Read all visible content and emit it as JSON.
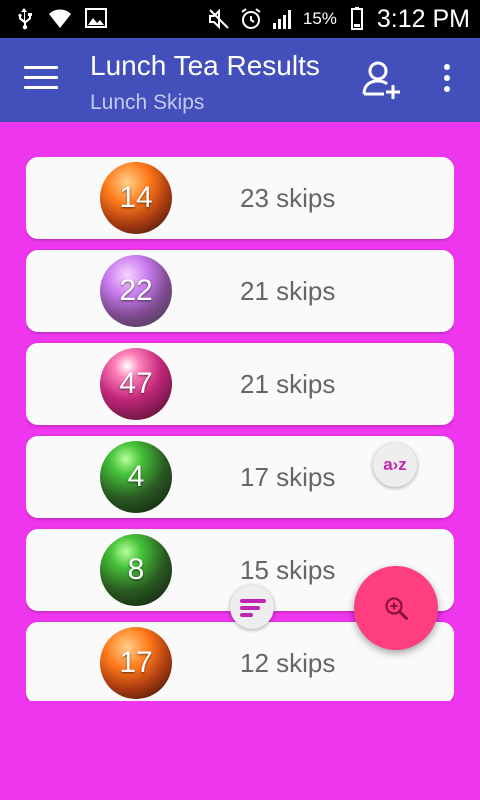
{
  "status_bar": {
    "battery_percent": "15%",
    "time": "3:12 PM",
    "icons": [
      "usb-icon",
      "wifi-icon",
      "image-icon",
      "mute-icon",
      "alarm-icon",
      "signal-icon",
      "battery-icon"
    ]
  },
  "app_bar": {
    "title": "Lunch Tea Results",
    "subtitle": "Lunch Skips",
    "bar_color": "#4350bb",
    "icons": [
      "menu-icon",
      "add-user-icon",
      "more-vert-icon"
    ]
  },
  "results": [
    {
      "ball": "14",
      "ball_color": "orange",
      "skips": "23 skips"
    },
    {
      "ball": "22",
      "ball_color": "lilac",
      "skips": "21 skips"
    },
    {
      "ball": "47",
      "ball_color": "pink",
      "skips": "21 skips"
    },
    {
      "ball": "4",
      "ball_color": "green",
      "skips": "17 skips"
    },
    {
      "ball": "8",
      "ball_color": "green",
      "skips": "15 skips"
    },
    {
      "ball": "17",
      "ball_color": "orange",
      "skips": "12 skips"
    }
  ],
  "floating": {
    "az_label": "a›z",
    "fab_icon": "zoom-icon",
    "sort_icon": "sort-icon",
    "fab_color": "#ff3e7f",
    "background_color": "#ee36ee"
  }
}
